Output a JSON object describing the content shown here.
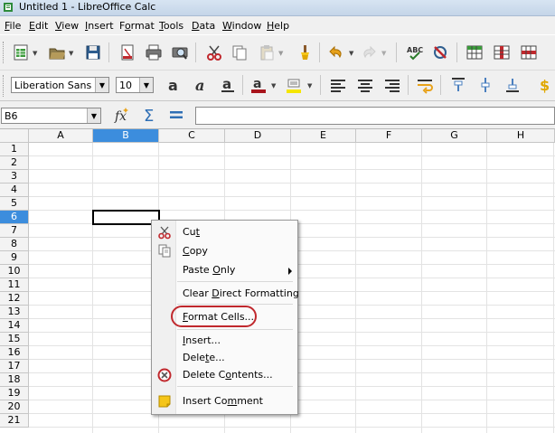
{
  "window": {
    "title": "Untitled 1 - LibreOffice Calc"
  },
  "menubar": [
    {
      "label": "File",
      "key": "F",
      "rest": "ile"
    },
    {
      "label": "Edit",
      "key": "E",
      "rest": "dit"
    },
    {
      "label": "View",
      "key": "V",
      "rest": "iew"
    },
    {
      "label": "Insert",
      "key": "I",
      "rest": "nsert"
    },
    {
      "label": "Format",
      "key": "o",
      "pre": "F",
      "rest": "rmat"
    },
    {
      "label": "Tools",
      "key": "T",
      "rest": "ools"
    },
    {
      "label": "Data",
      "key": "D",
      "rest": "ata"
    },
    {
      "label": "Window",
      "key": "W",
      "rest": "indow"
    },
    {
      "label": "Help",
      "key": "H",
      "rest": "elp"
    }
  ],
  "format_toolbar": {
    "font_name": "Liberation Sans",
    "font_size": "10"
  },
  "formula_bar": {
    "name_box": "B6",
    "formula": ""
  },
  "grid": {
    "columns": [
      "A",
      "B",
      "C",
      "D",
      "E",
      "F",
      "G",
      "H"
    ],
    "rows": [
      "1",
      "2",
      "3",
      "4",
      "5",
      "6",
      "7",
      "8",
      "9",
      "10",
      "11",
      "12",
      "13",
      "14",
      "15",
      "16",
      "17",
      "18",
      "19",
      "20",
      "21"
    ],
    "selected_cell": "B6",
    "selected_column": "B",
    "selected_row": "6"
  },
  "context_menu": {
    "cut": {
      "pre": "Cu",
      "key": "t",
      "post": ""
    },
    "copy": {
      "pre": "",
      "key": "C",
      "post": "opy"
    },
    "paste_only": {
      "pre": "Paste ",
      "key": "O",
      "post": "nly"
    },
    "clear_direct_formatting": {
      "pre": "Clear ",
      "key": "D",
      "post": "irect Formatting"
    },
    "format_cells": {
      "pre": "",
      "key": "F",
      "post": "ormat Cells..."
    },
    "insert": {
      "pre": "",
      "key": "I",
      "post": "nsert..."
    },
    "delete": {
      "pre": "Dele",
      "key": "t",
      "post": "e..."
    },
    "delete_contents": {
      "pre": "Delete C",
      "key": "o",
      "post": "ntents..."
    },
    "insert_comment": {
      "pre": "Insert Co",
      "key": "m",
      "post": "ment"
    }
  }
}
